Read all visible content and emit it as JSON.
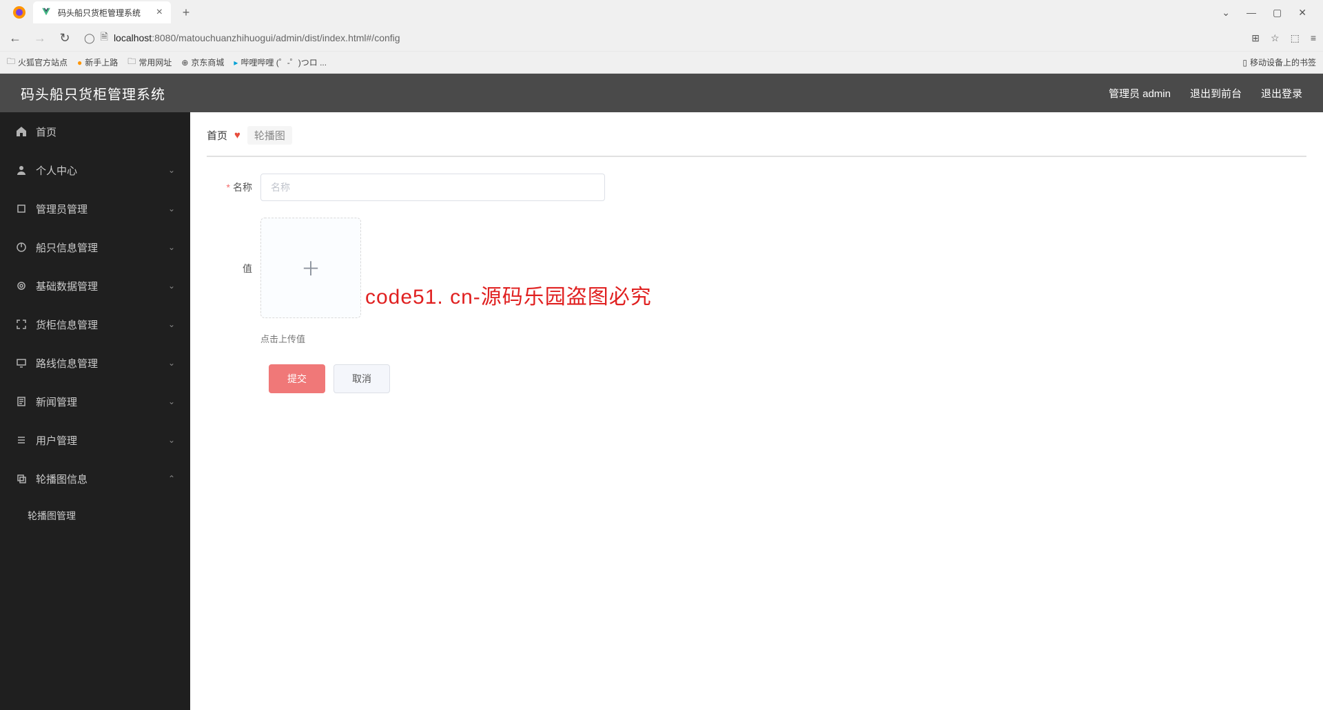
{
  "browser": {
    "tab_title": "码头船只货柜管理系统",
    "url_host": "localhost",
    "url_path": ":8080/matouchuanzhihuogui/admin/dist/index.html#/config",
    "bookmarks": [
      "火狐官方站点",
      "新手上路",
      "常用网址",
      "京东商城",
      "哔哩哔哩 (゜-゜)つロ ..."
    ],
    "bookmark_right": "移动设备上的书签"
  },
  "header": {
    "app_title": "码头船只货柜管理系统",
    "admin_label": "管理员 admin",
    "logout_front": "退出到前台",
    "logout": "退出登录"
  },
  "sidebar": {
    "items": [
      {
        "label": "首页",
        "expandable": false
      },
      {
        "label": "个人中心",
        "expandable": true
      },
      {
        "label": "管理员管理",
        "expandable": true
      },
      {
        "label": "船只信息管理",
        "expandable": true
      },
      {
        "label": "基础数据管理",
        "expandable": true
      },
      {
        "label": "货柜信息管理",
        "expandable": true
      },
      {
        "label": "路线信息管理",
        "expandable": true
      },
      {
        "label": "新闻管理",
        "expandable": true
      },
      {
        "label": "用户管理",
        "expandable": true
      },
      {
        "label": "轮播图信息",
        "expandable": true,
        "open": true
      }
    ],
    "submenu_label": "轮播图管理"
  },
  "breadcrumb": {
    "home": "首页",
    "current": "轮播图"
  },
  "form": {
    "name_label": "名称",
    "name_placeholder": "名称",
    "value_label": "值",
    "upload_hint": "点击上传值",
    "submit": "提交",
    "cancel": "取消"
  },
  "watermarks": {
    "text": "code51.cn",
    "center": "code51. cn-源码乐园盗图必究"
  }
}
